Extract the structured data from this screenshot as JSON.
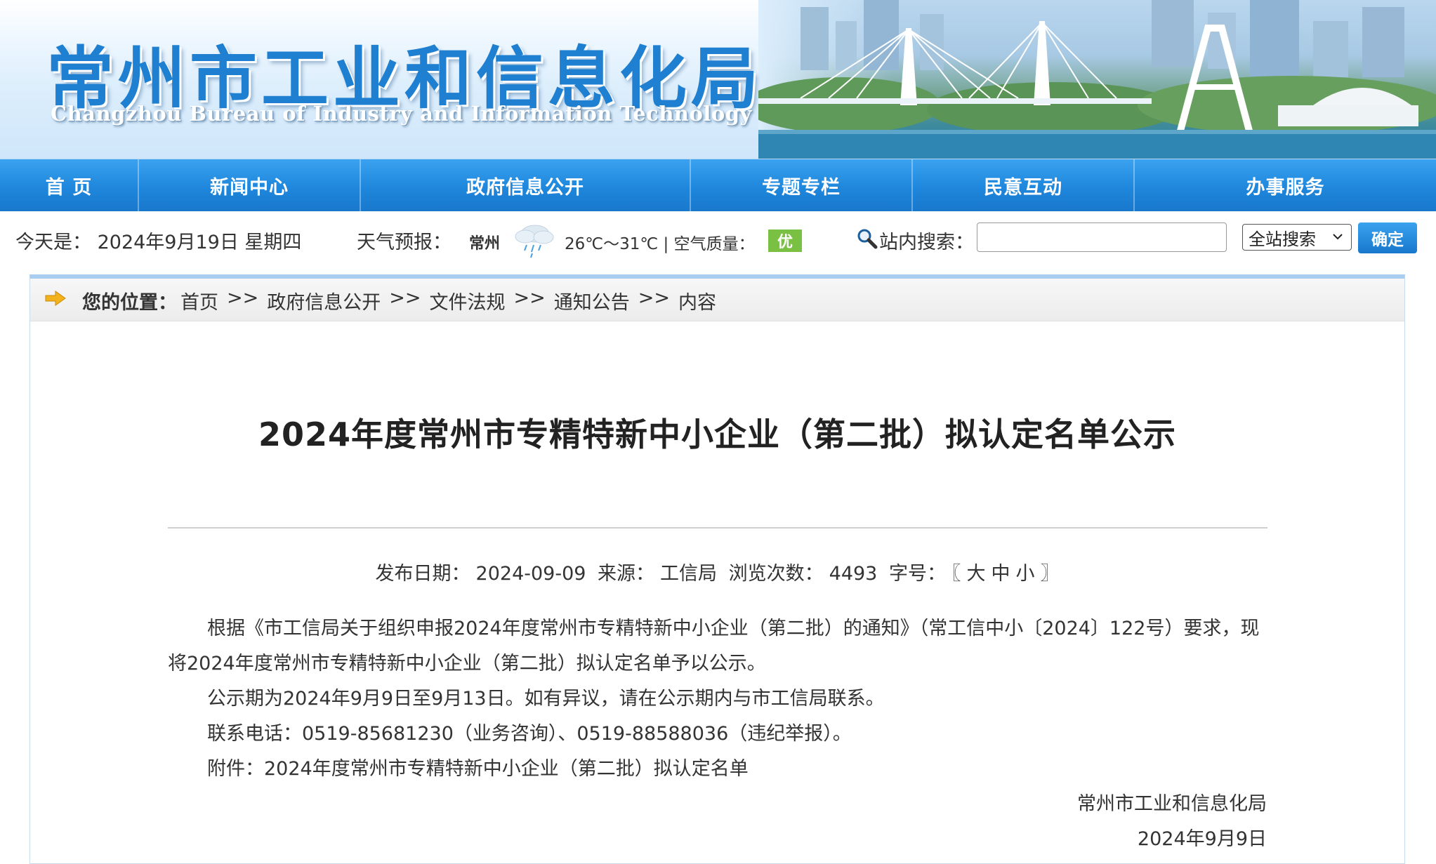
{
  "header": {
    "title": "常州市工业和信息化局",
    "subtitle": "Changzhou Bureau of Industry and Information Technology"
  },
  "nav": {
    "items": [
      "首 页",
      "新闻中心",
      "政府信息公开",
      "专题专栏",
      "民意互动",
      "办事服务"
    ]
  },
  "infobar": {
    "today": "今天是： 2024年9月19日 星期四",
    "weather_label": "天气预报：",
    "weather_city": "常州",
    "weather_icon": "rain-cloud-icon",
    "weather_temp": "26℃～31℃ | 空气质量：",
    "air_quality": "优",
    "search_label": "站内搜索：",
    "search_value": "",
    "search_scope": "全站搜索",
    "search_button": "确定"
  },
  "breadcrumb": {
    "label": "您的位置：",
    "items": [
      "首页",
      "政府信息公开",
      "文件法规",
      "通知公告",
      "内容"
    ],
    "separator": ">>"
  },
  "article": {
    "title": "2024年度常州市专精特新中小企业（第二批）拟认定名单公示",
    "meta": {
      "date_label": "发布日期：",
      "date": "2024-09-09",
      "source_label": "来源：",
      "source": "工信局",
      "views_label": "浏览次数：",
      "views": "4493",
      "font_label": "字号：",
      "font_open": "〖",
      "font_large": "大",
      "font_medium": "中",
      "font_small": "小",
      "font_close": "〗"
    },
    "paragraphs": [
      "根据《市工信局关于组织申报2024年度常州市专精特新中小企业（第二批）的通知》（常工信中小〔2024〕122号）要求，现将2024年度常州市专精特新中小企业（第二批）拟认定名单予以公示。",
      "公示期为2024年9月9日至9月13日。如有异议，请在公示期内与市工信局联系。",
      "联系电话：0519-85681230（业务咨询）、0519-88588036（违纪举报）。",
      "附件：2024年度常州市专精特新中小企业（第二批）拟认定名单"
    ],
    "signature_org": "常州市工业和信息化局",
    "signature_date": "2024年9月9日"
  },
  "colors": {
    "nav_blue": "#1f87dc",
    "title_blue": "#1f7fd0",
    "air_green": "#7ac143"
  }
}
